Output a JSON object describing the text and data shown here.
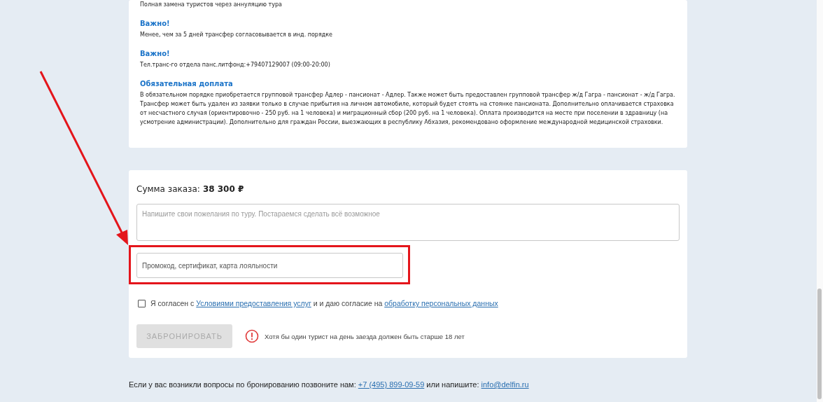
{
  "info_sections": [
    {
      "text": "Полная замена туристов через аннуляцию тура"
    },
    {
      "heading": "Важно!",
      "text": "Менее, чем за 5 дней трансфер согласовывается в инд. порядке"
    },
    {
      "heading": "Важно!",
      "text": "Тел.транс-го отдела панс.литфонд:+79407129007 (09:00-20:00)"
    },
    {
      "heading": "Обязательная доплата",
      "text": "В обязательном порядке приобретается групповой трансфер Адлер - пансионат - Адлер. Также может быть предоставлен групповой трансфер ж/д Гагра - пансионат - ж/д Гагра. Трансфер может быть удален из заявки только в случае прибытия на личном автомобиле, который будет стоять на стоянке пансионата. Дополнительно оплачивается страховка от несчастного случая (ориентировочно - 250 руб. на 1 человека) и миграционный сбор (200 руб. на 1 человека). Оплата производится на месте при поселении в здравницу (на усмотрение администрации). Дополнительно для граждан России, выезжающих в республику Абхазия, рекомендовано оформление международной медицинской страховки."
    }
  ],
  "order": {
    "total_label": "Сумма заказа:",
    "total_value": "38 300 ₽",
    "wishes": {
      "placeholder": "Напишите свои пожелания по туру. Постараемся сделать всё возможное"
    },
    "promo": {
      "placeholder": "Промокод, сертификат, карта лояльности",
      "highlighted": true
    },
    "consent": {
      "checked": false,
      "text_before": "Я согласен с",
      "link_1": "Условиями предоставления услуг",
      "text_middle": "и и даю согласие на",
      "link_2": "обработку персональных данных"
    },
    "book_button": {
      "label": "ЗАБРОНИРОВАТЬ",
      "disabled": true
    },
    "warning": "Хотя бы один турист на день заезда должен быть старше 18 лет"
  },
  "footer": {
    "text_before": "Если у вас возникли вопросы по бронированию позвоните нам:",
    "phone": "+7 (495) 899-09-59",
    "text_middle": "или напишите:",
    "email": "info@delfin.ru"
  }
}
